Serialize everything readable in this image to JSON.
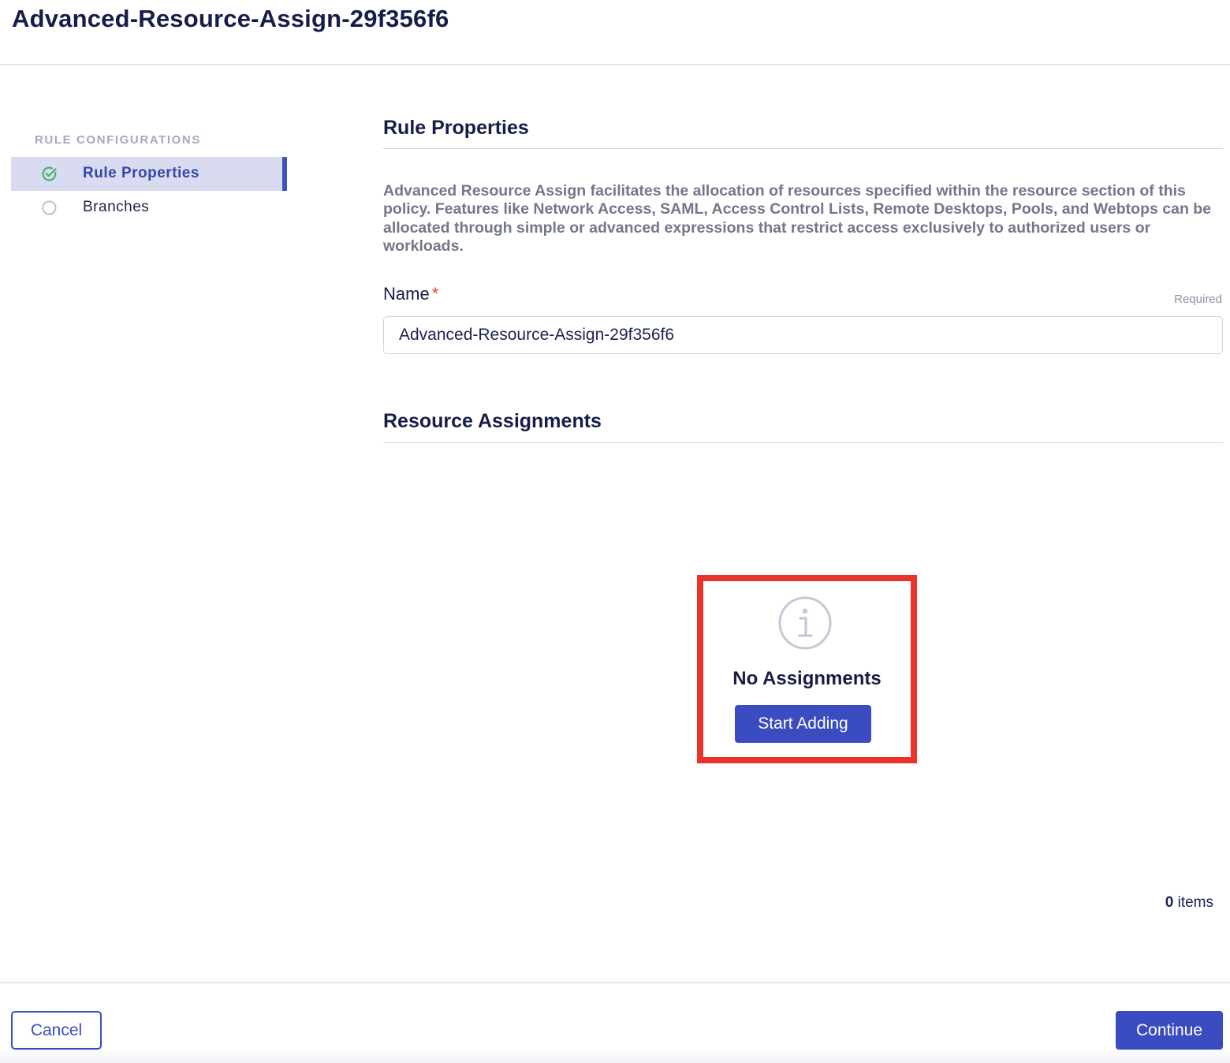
{
  "header": {
    "title": "Advanced-Resource-Assign-29f356f6"
  },
  "sidebar": {
    "heading": "RULE CONFIGURATIONS",
    "items": [
      {
        "label": "Rule Properties",
        "state": "completed",
        "icon": "check-circle-icon",
        "active": true
      },
      {
        "label": "Branches",
        "state": "pending",
        "icon": "empty-circle-icon",
        "active": false
      }
    ]
  },
  "main": {
    "rule_properties": {
      "title": "Rule Properties",
      "description": "Advanced Resource Assign facilitates the allocation of resources specified within the resource section of this policy. Features like Network Access, SAML, Access Control Lists, Remote Desktops, Pools, and Webtops can be allocated through simple or advanced expressions that restrict access exclusively to authorized users or workloads.",
      "name_label": "Name",
      "required_marker": "*",
      "required_hint": "Required",
      "name_value": "Advanced-Resource-Assign-29f356f6"
    },
    "resource_assignments": {
      "title": "Resource Assignments",
      "empty_icon": "info-icon",
      "empty_title": "No Assignments",
      "start_button": "Start Adding",
      "count": "0",
      "count_unit": "items"
    }
  },
  "footer": {
    "cancel_label": "Cancel",
    "continue_label": "Continue"
  },
  "colors": {
    "primary": "#3a4cbf",
    "active_bg": "#d9dcf0",
    "success": "#3cb371",
    "highlight": "#e8322a",
    "required": "#e5483a"
  }
}
